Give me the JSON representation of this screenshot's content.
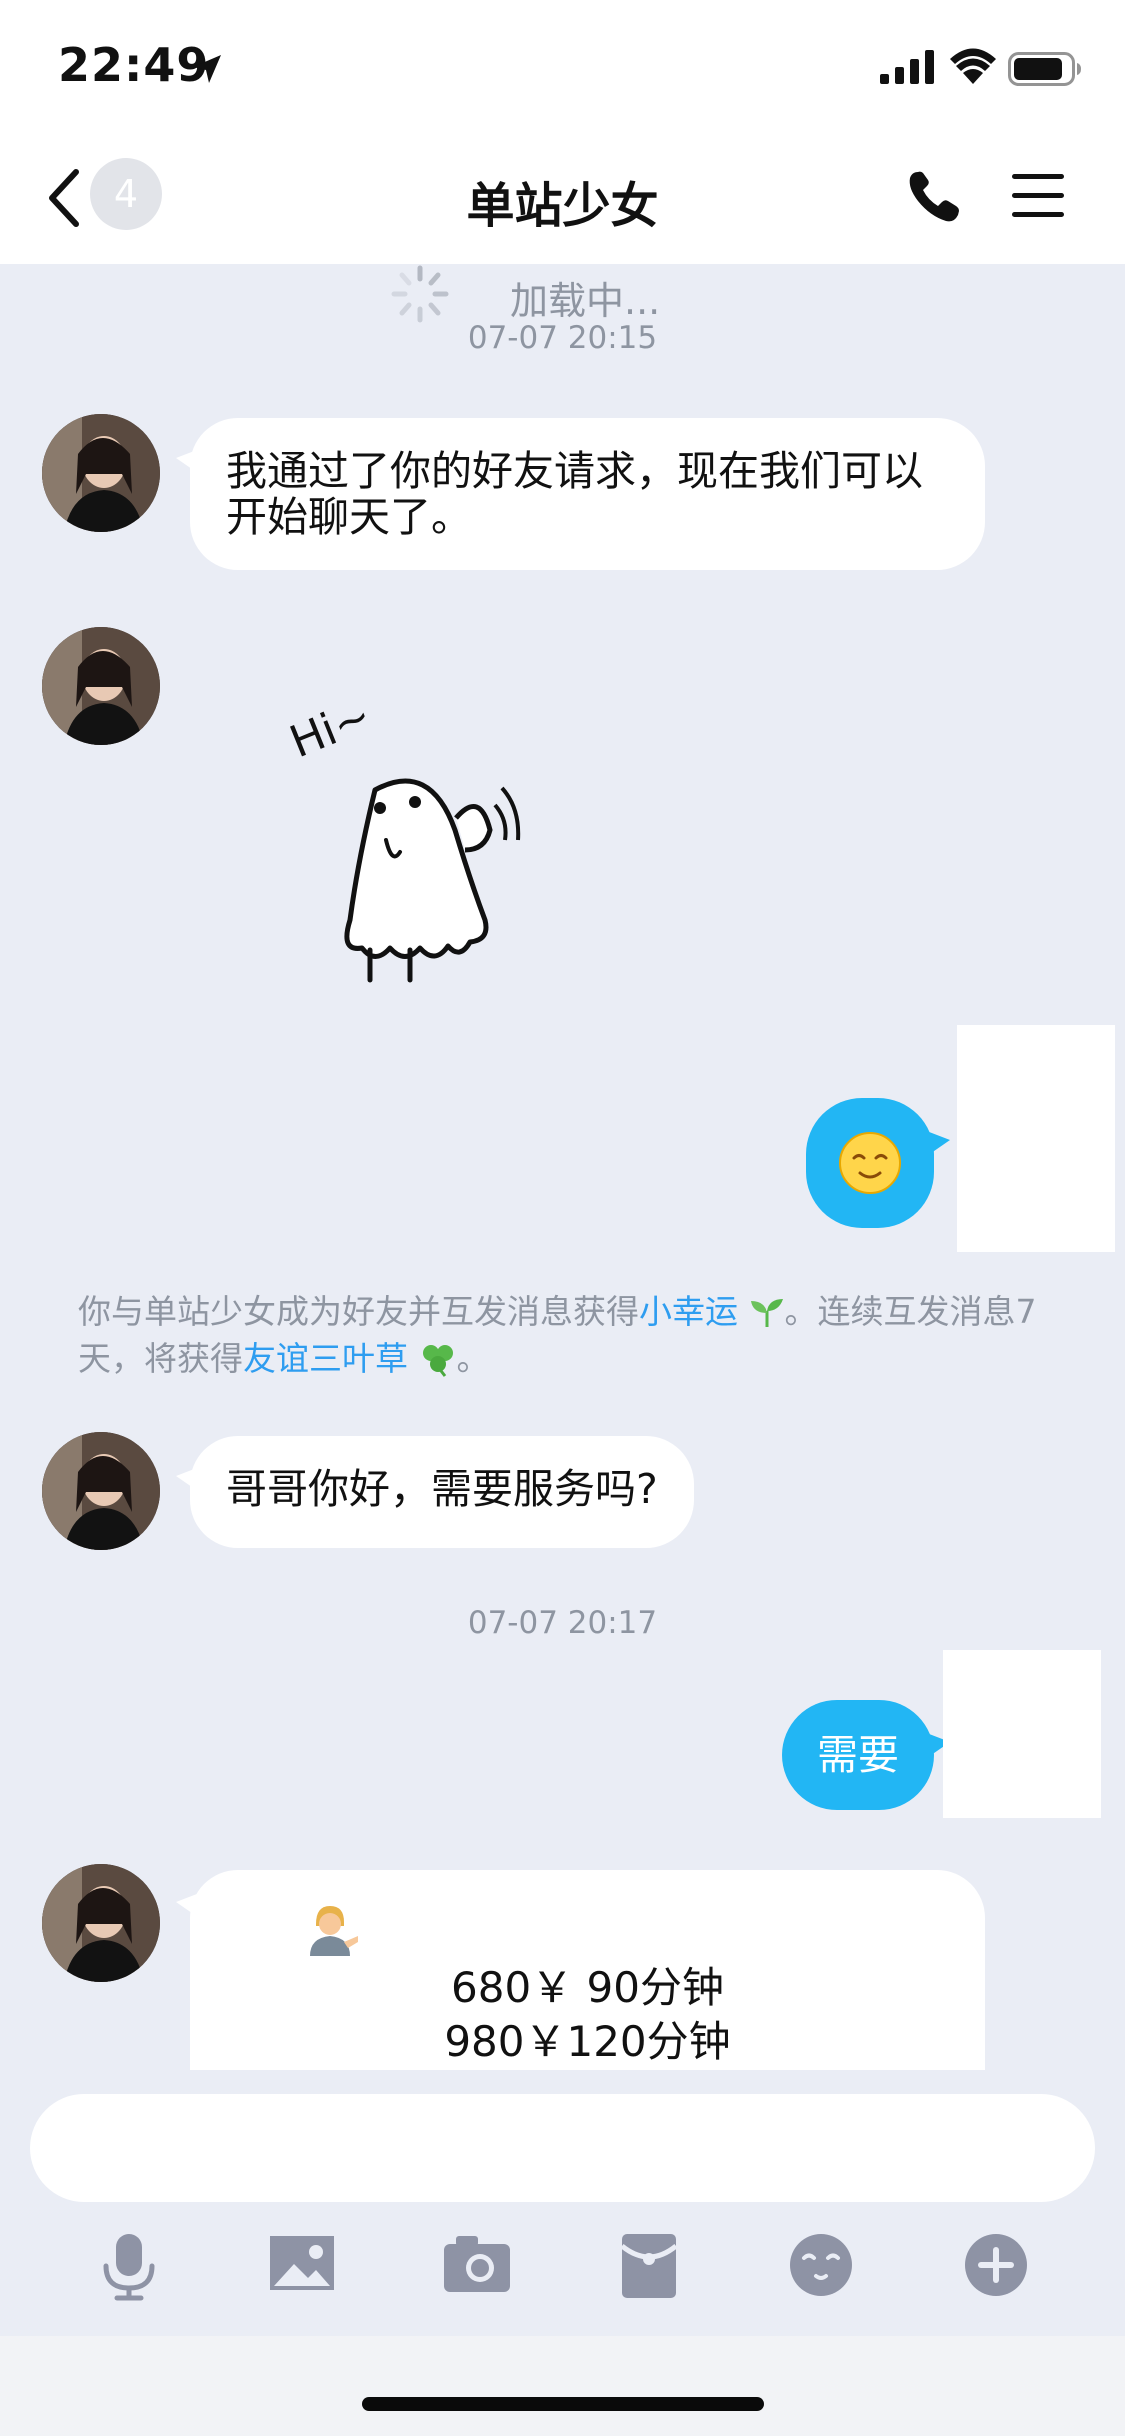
{
  "status_bar": {
    "time": "22:49",
    "icons": [
      "location-arrow-icon",
      "signal-icon",
      "wifi-icon",
      "battery-icon"
    ]
  },
  "nav": {
    "back_icon": "chevron-left-icon",
    "unread_count": "4",
    "title": "单站少女",
    "call_icon": "phone-icon",
    "menu_icon": "menu-icon"
  },
  "loading": {
    "text": "加载中..."
  },
  "messages": {
    "timestamp_1": "07-07 20:15",
    "msg_1": "我通过了你的好友请求，现在我们可以开始聊天了。",
    "msg_2_sticker": "ghost-hi-sticker",
    "msg_3_sticker_text": "Hi~",
    "msg_4_emoji": "smiling-face-emoji",
    "system_notice": {
      "part1": "你与单站少女成为好友并互发消息获得",
      "link1": "小幸运",
      "part2": "。连续互发消息7天，将获得",
      "link2": "友谊三叶草",
      "part3": "。"
    },
    "msg_5": "哥哥你好，需要服务吗?",
    "timestamp_2": "07-07 20:17",
    "msg_6": "需要",
    "msg_7_lines": [
      "680￥ 90分钟",
      "980￥120分钟"
    ]
  },
  "input": {
    "placeholder": ""
  },
  "toolbar": {
    "icons": [
      "microphone-icon",
      "image-icon",
      "camera-icon",
      "red-packet-icon",
      "emoji-icon",
      "plus-icon"
    ]
  },
  "colors": {
    "background": "#eaedf5",
    "outgoing_bubble": "#22b6f4",
    "link": "#2e9df0",
    "muted_text": "#8e95a1",
    "toolbar_icon": "#8e93a5"
  }
}
